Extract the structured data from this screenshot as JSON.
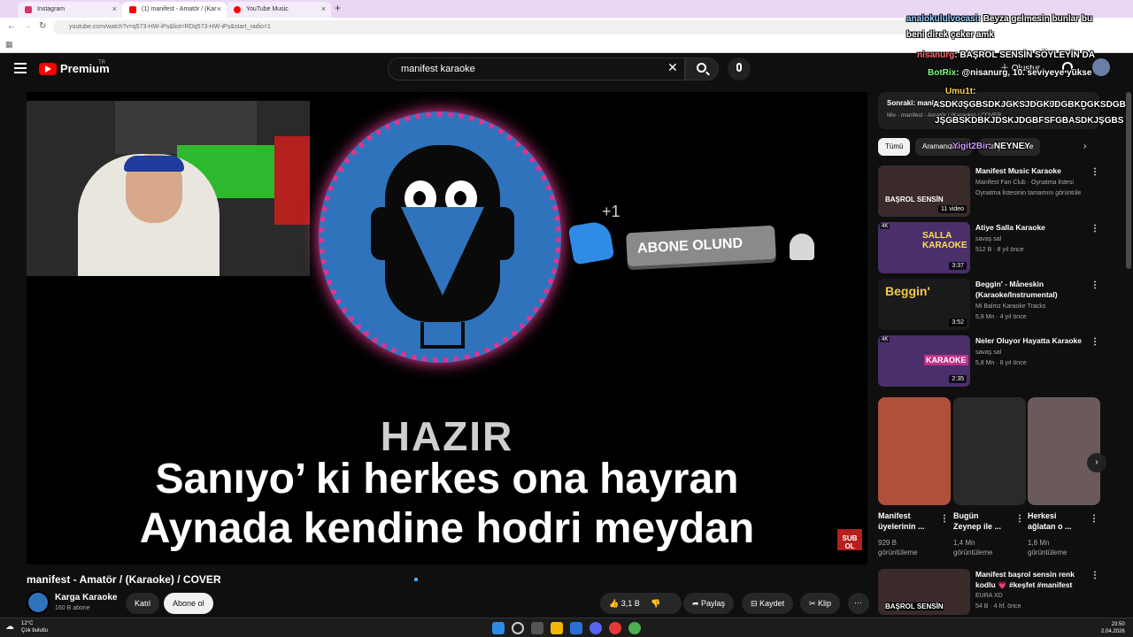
{
  "browser": {
    "tabs": [
      {
        "label": "Instagram",
        "color": "#e1306c"
      },
      {
        "label": "(1) manifest - Amatör / (Kar",
        "color": "#ff0000"
      },
      {
        "label": "YouTube Music",
        "color": "#ff0000"
      }
    ],
    "url": "youtube.com/watch?v=q573-HW-iPs&list=RDq573-HW-iPs&start_radio=1"
  },
  "header": {
    "logo": "Premium",
    "country": "TR",
    "search_value": "manifest karaoke",
    "create_label": "Oluştur"
  },
  "video": {
    "hazir": "HAZIR",
    "lyric_line1": "Sanıyo’ ki herkes ona hayran",
    "lyric_line2": "Aynada kendine hodri meydan",
    "subscribe_anim": "ABONE OLUND",
    "plus_one": "+1",
    "corner_badge": "SUB OL",
    "title": "manifest - Amatör / (Karaoke) / COVER",
    "channel_name": "Karga Karaoke",
    "channel_subs": "160 B abone",
    "join_label": "Katıl",
    "subscribe_label": "Abone ol",
    "like_count": "3,1 B",
    "share_label": "Paylaş",
    "save_label": "Kaydet",
    "clip_label": "Klip"
  },
  "sidebar": {
    "upnext_title": "Sonraki: manifest - Başrol Sensin / (Karaoke) / COV...",
    "upnext_sub": "Mix - manifest - Amatör / (Karaoke) / COVER",
    "chips": [
      "Tümü",
      "Aramanızdan",
      "Karga Karaoke"
    ],
    "recs": [
      {
        "title": "Manifest Music Karaoke",
        "meta1": "Manifest Fan Club · Oynatma listesi",
        "meta2": "Oynatma listesinin tamamını görüntüle",
        "badge": "11 video",
        "thumb_text": "BAŞROL SENSİN",
        "thumb_color": "#3a2a2a"
      },
      {
        "title": "Atiye Salla Karaoke",
        "meta1": "savaş sal",
        "meta2": "512 B · 8 yıl önce",
        "badge": "3:37",
        "thumb_text": "SALLA KARAOKE",
        "thumb_color": "#4a2f6a"
      },
      {
        "title": "Beggin' - Måneskin (Karaoke/Instrumental)",
        "meta1": "Mi Balmz Karaoke Tracks",
        "meta2": "5,8 Mn · 4 yıl önce",
        "badge": "3:52",
        "thumb_text": "Beggin'",
        "thumb_color": "#1a1a1a"
      },
      {
        "title": "Neler Oluyor Hayatta Karaoke",
        "meta1": "savaş sal",
        "meta2": "5,8 Mn · 8 yıl önce",
        "badge": "2:35",
        "thumb_text": "KARAOKE",
        "thumb_color": "#4a2f6a"
      }
    ],
    "shorts": [
      {
        "title": "Manifest üyelerinin ...",
        "views1": "929 B",
        "views2": "görüntüleme",
        "color": "#b0503a"
      },
      {
        "title": "Bugün Zeynep ile ...",
        "views1": "1,4 Mn",
        "views2": "görüntüleme",
        "color": "#2a2a2a"
      },
      {
        "title": "Herkesi ağlatan o ...",
        "views1": "1,8 Mn",
        "views2": "görüntüleme",
        "color": "#6a5a5a"
      }
    ],
    "last_rec": {
      "title": "Manifest başrol sensin renk kodlu 💗 #keşfet #manifest",
      "meta1": "EURA XD",
      "meta2": "54 B · 4 hf. önce",
      "thumb_text": "BAŞROL SENSİN"
    }
  },
  "chat": [
    {
      "user": "analokululvocasi",
      "text": ": Beyza gelmesin bunlar bu"
    },
    {
      "user": "",
      "text": "beni direk çeker amk"
    },
    {
      "user": "nisanurg",
      "text": ": BAŞROL SENSİN SÖYLEYİN DA"
    },
    {
      "user": "BotRix",
      "text": ": @nisanurg, 10. seviyeye yükse"
    },
    {
      "user": "Umu1t",
      "text": ":"
    },
    {
      "user": "",
      "text": "ASDKJŞGBSDKJGKSJDGKJDGBKDGKSDGB"
    },
    {
      "user": "",
      "text": "JŞGBSKDBKJDSKJDGBFSFGBASDKJŞGBS"
    },
    {
      "user": "Yigit2Bir",
      "text": ": NEYNEY"
    }
  ],
  "taskbar": {
    "temp": "12°C",
    "weather": "Çok bulutlu",
    "time": "23:50",
    "date": "2.04.2026"
  }
}
